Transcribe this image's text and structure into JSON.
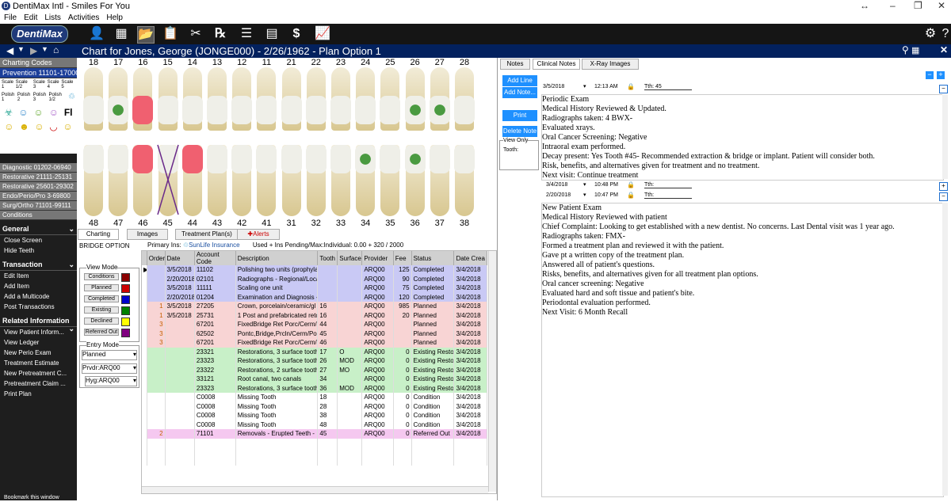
{
  "window": {
    "title": "DentiMax Intl - Smiles For You"
  },
  "menu": [
    "File",
    "Edit",
    "Lists",
    "Activities",
    "Help"
  ],
  "logo": "DentiMax",
  "chart_header": {
    "title": "Chart for Jones, George (JONGE000) - 2/26/1962 - Plan Option 1"
  },
  "sidebar": {
    "codes": [
      "Charting Codes",
      "Prevention 11101-17000"
    ],
    "scale_row": [
      "Scale 1",
      "Scale 1/2",
      "Scale 3",
      "Scale 4",
      "Scale 5"
    ],
    "polish_row": [
      "Polish 1",
      "Polish 2",
      "Polish 3",
      "Polish 1/2"
    ],
    "fl_label": "Fl",
    "categories": [
      "Diagnostic 01202-06940",
      "Restorative 21111-25131",
      "Restorative 25601-29302",
      "Endo/Perio/Pro 3-69800",
      "Surg/Ortho 71101-99111",
      "Conditions"
    ],
    "general_title": "General",
    "general": [
      "Close Screen",
      "Hide Teeth"
    ],
    "transaction_title": "Transaction",
    "transaction": [
      "Edit Item",
      "Add Item",
      "Add a Multicode",
      "Post Transactions"
    ],
    "related_title": "Related Information",
    "related": [
      "View Patient Inform...",
      "View Ledger",
      "New Perio Exam",
      "Treatment Estimate",
      "New Pretreatment C...",
      "Pretreatment Claim ...",
      "Print Plan"
    ],
    "bookmark": "Bookmark this window"
  },
  "teeth": {
    "upper": [
      "18",
      "17",
      "16",
      "15",
      "14",
      "13",
      "12",
      "11",
      "21",
      "22",
      "23",
      "24",
      "25",
      "26",
      "27",
      "28"
    ],
    "lower": [
      "48",
      "47",
      "46",
      "45",
      "44",
      "43",
      "42",
      "41",
      "31",
      "32",
      "33",
      "34",
      "35",
      "36",
      "37",
      "38"
    ]
  },
  "chart_tabs": [
    "Charting",
    "Images",
    "Treatment Plan(s)",
    "Alerts"
  ],
  "bridge_option": "BRIDGE OPTION",
  "insurance": {
    "label": "Primary Ins:",
    "name": "SunLife Insurance",
    "used": "Used + Ins Pending/Max:Individual: 0.00 + 320 / 2000"
  },
  "view_mode": {
    "title": "View Mode",
    "items": [
      "Conditions",
      "Planned",
      "Completed",
      "Existing",
      "Declined",
      "Referred Out"
    ],
    "colors": [
      "#8b0000",
      "#cc0000",
      "#0000cc",
      "#008000",
      "#ffff00",
      "#800080"
    ]
  },
  "entry_mode": {
    "title": "Entry Mode",
    "value": "Planned",
    "prvdr": "Prvdr:ARQ00",
    "hyg": "Hyg:ARQ00"
  },
  "table": {
    "headers": [
      "Order",
      "Date",
      "Account Code",
      "Description",
      "Tooth",
      "Surface",
      "Provider",
      "Fee",
      "Status",
      "Date Crea"
    ],
    "rows": [
      {
        "order": "",
        "date": "3/5/2018",
        "code": "11102",
        "desc": "Polishing  two units (prophyla",
        "tooth": "",
        "surf": "",
        "prov": "ARQ00",
        "fee": "125",
        "status": "Completed",
        "dc": "3/4/2018",
        "bg": "#c9c9f5"
      },
      {
        "order": "",
        "date": "2/20/2018",
        "code": "02101",
        "desc": "Radiographs - Regional/Loca",
        "tooth": "",
        "surf": "",
        "prov": "ARQ00",
        "fee": "90",
        "status": "Completed",
        "dc": "3/4/2018",
        "bg": "#c9c9f5"
      },
      {
        "order": "",
        "date": "3/5/2018",
        "code": "11111",
        "desc": "Scaling one unit",
        "tooth": "",
        "surf": "",
        "prov": "ARQ00",
        "fee": "75",
        "status": "Completed",
        "dc": "3/4/2018",
        "bg": "#c9c9f5"
      },
      {
        "order": "",
        "date": "2/20/2018",
        "code": "01204",
        "desc": "Examination and Diagnosis -",
        "tooth": "",
        "surf": "",
        "prov": "ARQ00",
        "fee": "120",
        "status": "Completed",
        "dc": "3/4/2018",
        "bg": "#c9c9f5"
      },
      {
        "order": "1",
        "date": "3/5/2018",
        "code": "27205",
        "desc": "Crown, porcelain/ceramic/gl",
        "tooth": "16",
        "surf": "",
        "prov": "ARQ00",
        "fee": "985",
        "status": "Planned",
        "dc": "3/4/2018",
        "bg": "#f8d4d4"
      },
      {
        "order": "1",
        "date": "3/5/2018",
        "code": "25731",
        "desc": "1 Post and prefabricated retc",
        "tooth": "16",
        "surf": "",
        "prov": "ARQ00",
        "fee": "20",
        "status": "Planned",
        "dc": "3/4/2018",
        "bg": "#f8d4d4"
      },
      {
        "order": "3",
        "date": "",
        "code": "67201",
        "desc": "FixedBridge Ret Porc/Cerm/F",
        "tooth": "44",
        "surf": "",
        "prov": "ARQ00",
        "fee": "",
        "status": "Planned",
        "dc": "3/4/2018",
        "bg": "#f8d4d4"
      },
      {
        "order": "3",
        "date": "",
        "code": "62502",
        "desc": "Pontc,Bridge,Prcln/Cerm/Pol",
        "tooth": "45",
        "surf": "",
        "prov": "ARQ00",
        "fee": "",
        "status": "Planned",
        "dc": "3/4/2018",
        "bg": "#f8d4d4"
      },
      {
        "order": "3",
        "date": "",
        "code": "67201",
        "desc": "FixedBridge Ret Porc/Cerm/F",
        "tooth": "46",
        "surf": "",
        "prov": "ARQ00",
        "fee": "",
        "status": "Planned",
        "dc": "3/4/2018",
        "bg": "#f8d4d4"
      },
      {
        "order": "",
        "date": "",
        "code": "23321",
        "desc": "Restorations, 3 surface tooth",
        "tooth": "17",
        "surf": "O",
        "prov": "ARQ00",
        "fee": "0",
        "status": "Existing Resto",
        "dc": "3/4/2018",
        "bg": "#c8f0c8"
      },
      {
        "order": "",
        "date": "",
        "code": "23323",
        "desc": "Restorations, 3 surface tooth",
        "tooth": "26",
        "surf": "MOD",
        "prov": "ARQ00",
        "fee": "0",
        "status": "Existing Resto",
        "dc": "3/4/2018",
        "bg": "#c8f0c8"
      },
      {
        "order": "",
        "date": "",
        "code": "23322",
        "desc": "Restorations, 2 surface tooth",
        "tooth": "27",
        "surf": "MO",
        "prov": "ARQ00",
        "fee": "0",
        "status": "Existing Resto",
        "dc": "3/4/2018",
        "bg": "#c8f0c8"
      },
      {
        "order": "",
        "date": "",
        "code": "33121",
        "desc": "Root canal, two canals",
        "tooth": "34",
        "surf": "",
        "prov": "ARQ00",
        "fee": "0",
        "status": "Existing Resto",
        "dc": "3/4/2018",
        "bg": "#c8f0c8"
      },
      {
        "order": "",
        "date": "",
        "code": "23323",
        "desc": "Restorations, 3 surface tooth",
        "tooth": "36",
        "surf": "MOD",
        "prov": "ARQ00",
        "fee": "0",
        "status": "Existing Resto",
        "dc": "3/4/2018",
        "bg": "#c8f0c8"
      },
      {
        "order": "",
        "date": "",
        "code": "C0008",
        "desc": "Missing Tooth",
        "tooth": "18",
        "surf": "",
        "prov": "ARQ00",
        "fee": "0",
        "status": "Condition",
        "dc": "3/4/2018",
        "bg": "#ffffff"
      },
      {
        "order": "",
        "date": "",
        "code": "C0008",
        "desc": "Missing Tooth",
        "tooth": "28",
        "surf": "",
        "prov": "ARQ00",
        "fee": "0",
        "status": "Condition",
        "dc": "3/4/2018",
        "bg": "#ffffff"
      },
      {
        "order": "",
        "date": "",
        "code": "C0008",
        "desc": "Missing Tooth",
        "tooth": "38",
        "surf": "",
        "prov": "ARQ00",
        "fee": "0",
        "status": "Condition",
        "dc": "3/4/2018",
        "bg": "#ffffff"
      },
      {
        "order": "",
        "date": "",
        "code": "C0008",
        "desc": "Missing Tooth",
        "tooth": "48",
        "surf": "",
        "prov": "ARQ00",
        "fee": "0",
        "status": "Condition",
        "dc": "3/4/2018",
        "bg": "#ffffff"
      },
      {
        "order": "2",
        "date": "",
        "code": "71101",
        "desc": "Removals - Erupted Teeth -",
        "tooth": "45",
        "surf": "",
        "prov": "ARQ00",
        "fee": "0",
        "status": "Referred Out",
        "dc": "3/4/2018",
        "bg": "#f5c8f0"
      }
    ]
  },
  "notes": {
    "tabs": [
      "Notes",
      "Clinical Notes",
      "X-Ray Images"
    ],
    "buttons": [
      "Add Line",
      "Add Note...",
      "Print",
      "Delete Note"
    ],
    "view_only": "View Only",
    "tooth_label": "Tooth:",
    "entries": [
      {
        "date": "3/5/2018",
        "time": "12:13 AM",
        "tth": "Tth:  45",
        "lines": [
          "Periodic Exam",
          "Medical History Reviewed & Updated.",
          "Radiographs taken: 4 BWX-",
          "Evaluated xrays.",
          "Oral Cancer Screening: Negative",
          "Intraoral exam performed.",
          "Decay present: Yes Tooth #45- Recommended extraction & bridge or implant. Patient will consider both.",
          "Risk, benefits, and alternatives given for treatment and no treatment.",
          "Next visit: Continue treatment"
        ]
      },
      {
        "date": "3/4/2018",
        "time": "10:48 PM",
        "tth": "Tth:",
        "lines": []
      },
      {
        "date": "2/20/2018",
        "time": "10:47 PM",
        "tth": "Tth:",
        "lines": [
          "New Patient Exam",
          "Medical History Reviewed with patient",
          "Chief Complaint: Looking to get established with a new dentist. No concerns. Last Dental visit was 1 year ago.",
          "Radiographs taken: FMX-",
          "Formed a treatment plan and reviewed it with the patient.",
          "Gave pt a written copy of the treatment plan.",
          "Answered all of patient's questions.",
          "Risks, benefits, and alternatives given for all treatment plan options.",
          "Oral cancer screening: Negative",
          "Evaluated hard and soft tissue and patient's bite.",
          "Periodontal evaluation performed.",
          "Next Visit: 6 Month Recall"
        ]
      }
    ]
  }
}
